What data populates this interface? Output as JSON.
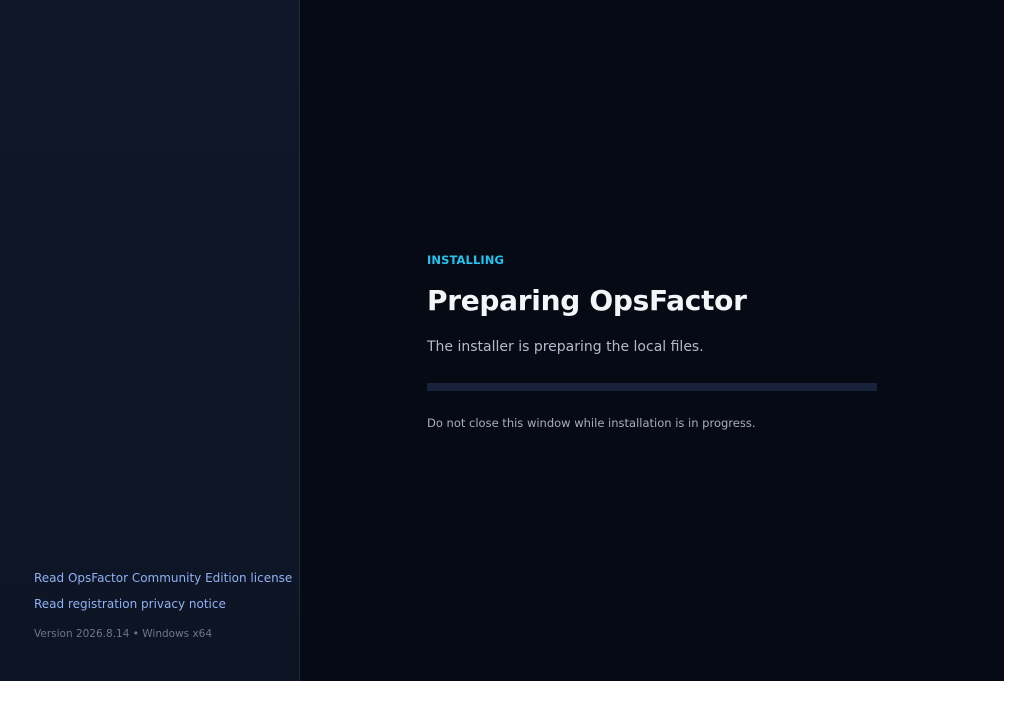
{
  "install": {
    "status_label": "INSTALLING",
    "title": "Preparing OpsFactor",
    "subtitle": "The installer is preparing the local files.",
    "progress_fraction": 0,
    "warning": "Do not close this window while installation is in progress."
  },
  "sidebar": {
    "license_link": "Read OpsFactor Community Edition license",
    "privacy_link": "Read registration privacy notice",
    "version": "Version 2026.8.14 • Windows x64"
  },
  "colors": {
    "accent": "#27c3f0",
    "link": "#8fb0f2",
    "background": "#050a14",
    "sidebar": "#0f1728"
  }
}
